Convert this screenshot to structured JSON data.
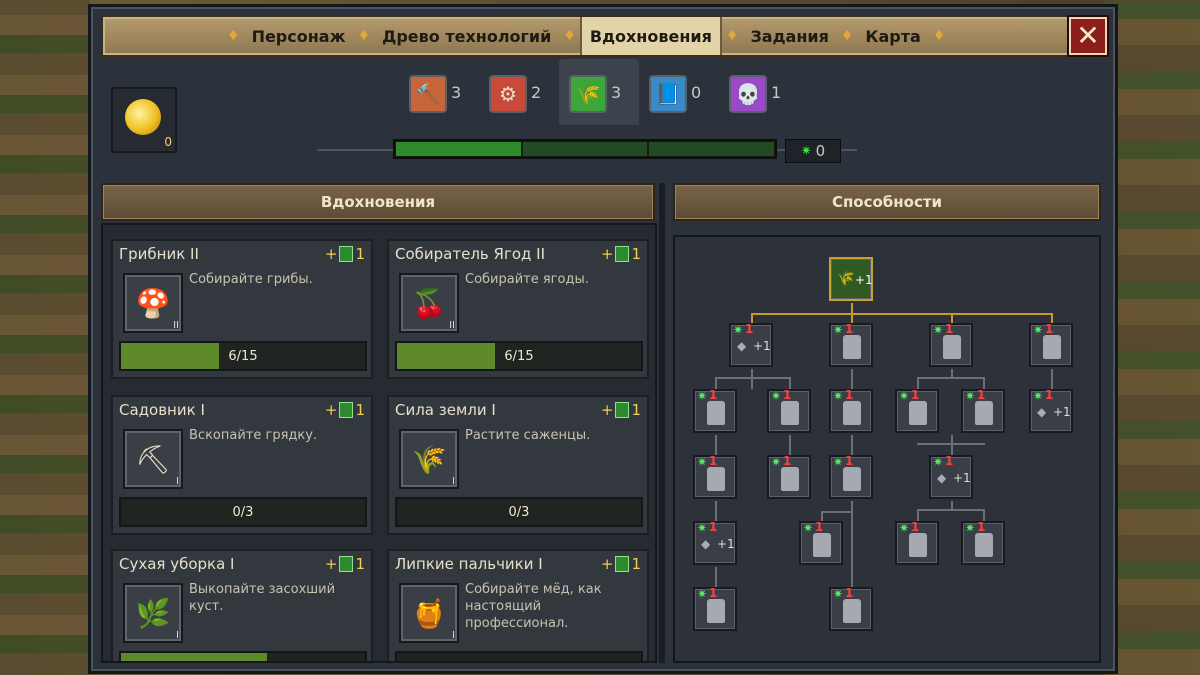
{
  "tabs": [
    "Персонаж",
    "Древо технологий",
    "Вдохновения",
    "Задания",
    "Карта"
  ],
  "active_tab": "Вдохновения",
  "close_label": "✕",
  "coins": {
    "icon": "gold-coin-icon",
    "count": "0"
  },
  "resources": [
    {
      "icon": "hammer-icon",
      "glyph": "🔨",
      "count": "3",
      "color": "#c8643a"
    },
    {
      "icon": "gear-icon",
      "glyph": "⚙",
      "count": "2",
      "color": "#c84a3a"
    },
    {
      "icon": "wheat-icon",
      "glyph": "🌾",
      "count": "3",
      "color": "#3ca63a"
    },
    {
      "icon": "book-icon",
      "glyph": "📘",
      "count": "0",
      "color": "#3a8ac8"
    },
    {
      "icon": "skull-icon",
      "glyph": "💀",
      "count": "1",
      "color": "#9a4ac8"
    }
  ],
  "progress": {
    "segments_total": 3,
    "segments_filled": 1
  },
  "gem_count": "0",
  "left_header": "Вдохновения",
  "right_header": "Способности",
  "cards": [
    {
      "title": "Грибник II",
      "reward": "1",
      "desc": "Собирайте грибы.",
      "icon": "mushroom-icon",
      "glyph": "🍄",
      "level": "II",
      "progress": "6/15",
      "fraction": 0.4
    },
    {
      "title": "Собиратель Ягод II",
      "reward": "1",
      "desc": "Собирайте ягоды.",
      "icon": "berries-icon",
      "glyph": "🍒",
      "level": "II",
      "progress": "6/15",
      "fraction": 0.4
    },
    {
      "title": "Садовник I",
      "reward": "1",
      "desc": "Вскопайте грядку.",
      "icon": "shovel-icon",
      "glyph": "⛏",
      "level": "I",
      "progress": "0/3",
      "fraction": 0
    },
    {
      "title": "Сила земли I",
      "reward": "1",
      "desc": "Растите саженцы.",
      "icon": "wheat-icon",
      "glyph": "🌾",
      "level": "I",
      "progress": "0/3",
      "fraction": 0
    },
    {
      "title": "Сухая уборка I",
      "reward": "1",
      "desc": "Выкопайте засохший куст.",
      "icon": "bush-icon",
      "glyph": "🌿",
      "level": "I",
      "progress": "",
      "fraction": 0.6
    },
    {
      "title": "Липкие пальчики I",
      "reward": "1",
      "desc": "Собирайте мёд, как настоящий профессионал.",
      "icon": "honey-icon",
      "glyph": "🍯",
      "level": "I",
      "progress": "",
      "fraction": 0
    }
  ],
  "tree": {
    "root_label": "+1",
    "plus_label": "+1",
    "one_label": "1",
    "star": "✷"
  }
}
